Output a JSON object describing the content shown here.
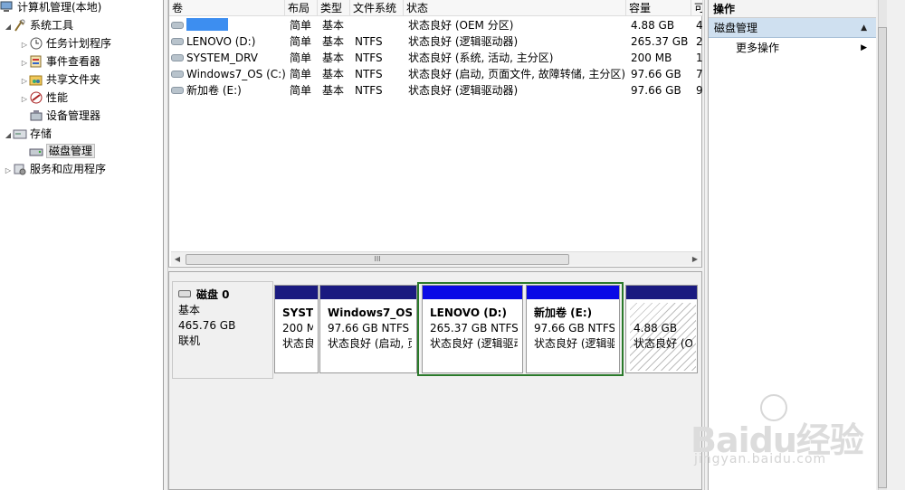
{
  "tree": {
    "items": [
      {
        "label": "计算机管理(本地)",
        "level": 0,
        "expander": "",
        "icon": "computer-icon"
      },
      {
        "label": "系统工具",
        "level": 1,
        "expander": "◢",
        "icon": "tools-icon"
      },
      {
        "label": "任务计划程序",
        "level": 2,
        "expander": "▷",
        "icon": "clock-icon"
      },
      {
        "label": "事件查看器",
        "level": 2,
        "expander": "▷",
        "icon": "event-viewer-icon"
      },
      {
        "label": "共享文件夹",
        "level": 2,
        "expander": "▷",
        "icon": "shared-folder-icon"
      },
      {
        "label": "性能",
        "level": 2,
        "expander": "▷",
        "icon": "performance-icon"
      },
      {
        "label": "设备管理器",
        "level": 2,
        "expander": "",
        "icon": "device-manager-icon"
      },
      {
        "label": "存储",
        "level": 1,
        "expander": "◢",
        "icon": "storage-icon"
      },
      {
        "label": "磁盘管理",
        "level": 2,
        "expander": "",
        "icon": "disk-management-icon",
        "selected": true
      },
      {
        "label": "服务和应用程序",
        "level": 1,
        "expander": "▷",
        "icon": "services-icon"
      }
    ]
  },
  "volumes": {
    "headers": [
      "卷",
      "布局",
      "类型",
      "文件系统",
      "状态",
      "容量",
      "可"
    ],
    "rows": [
      {
        "name": "",
        "redacted": true,
        "layout": "简单",
        "type": "基本",
        "fs": "",
        "status": "状态良好 (OEM 分区)",
        "capacity": "4.88 GB",
        "free": "4"
      },
      {
        "name": "LENOVO (D:)",
        "layout": "简单",
        "type": "基本",
        "fs": "NTFS",
        "status": "状态良好 (逻辑驱动器)",
        "capacity": "265.37 GB",
        "free": "2"
      },
      {
        "name": "SYSTEM_DRV",
        "layout": "简单",
        "type": "基本",
        "fs": "NTFS",
        "status": "状态良好 (系统, 活动, 主分区)",
        "capacity": "200 MB",
        "free": "1"
      },
      {
        "name": "Windows7_OS (C:)",
        "layout": "简单",
        "type": "基本",
        "fs": "NTFS",
        "status": "状态良好 (启动, 页面文件, 故障转储, 主分区)",
        "capacity": "97.66 GB",
        "free": "7"
      },
      {
        "name": "新加卷 (E:)",
        "layout": "简单",
        "type": "基本",
        "fs": "NTFS",
        "status": "状态良好 (逻辑驱动器)",
        "capacity": "97.66 GB",
        "free": "9"
      }
    ],
    "scroll_thumb_glyph": "III"
  },
  "disk": {
    "name": "磁盘 0",
    "type": "基本",
    "size": "465.76 GB",
    "state": "联机",
    "partitions": [
      {
        "name": "SYSTE",
        "size": "200 M",
        "status": "状态良"
      },
      {
        "name": "Windows7_OS",
        "size": "97.66 GB NTFS",
        "status": "状态良好 (启动, 页"
      },
      {
        "name": "LENOVO  (D:)",
        "size": "265.37 GB NTFS",
        "status": "状态良好 (逻辑驱动"
      },
      {
        "name": "新加卷  (E:)",
        "size": "97.66 GB NTFS",
        "status": "状态良好 (逻辑驱"
      },
      {
        "name": "",
        "size": "4.88 GB",
        "status": "状态良好 (OI"
      }
    ]
  },
  "actions": {
    "title": "操作",
    "group": "磁盘管理",
    "more": "更多操作"
  },
  "watermark": {
    "logo": "Baidu经验",
    "url": "jingyan.baidu.com"
  }
}
